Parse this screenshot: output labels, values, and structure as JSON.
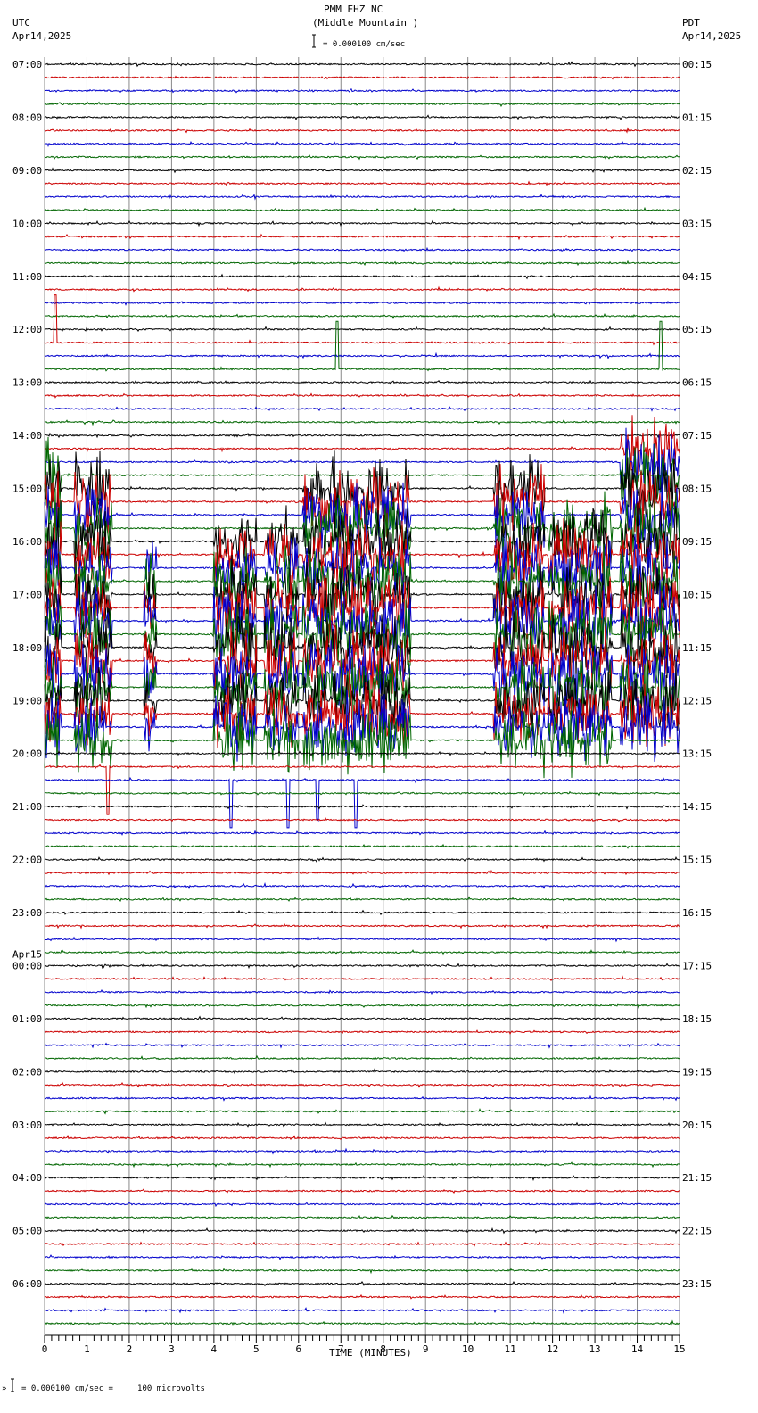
{
  "header": {
    "title": "PMM EHZ NC",
    "subtitle": "(Middle Mountain )",
    "left_tz": "UTC",
    "left_date": "Apr14,2025",
    "right_tz": "PDT",
    "right_date": "Apr14,2025",
    "scale_text": "= 0.000100 cm/sec"
  },
  "footer": {
    "scale_text": "= 0.000100 cm/sec =     100 microvolts"
  },
  "chart_data": {
    "type": "line",
    "title": "PMM EHZ NC (Middle Mountain )",
    "xlabel": "TIME (MINUTES)",
    "xlim": [
      0,
      15
    ],
    "x_ticks": [
      "0",
      "1",
      "2",
      "3",
      "4",
      "5",
      "6",
      "7",
      "8",
      "9",
      "10",
      "11",
      "12",
      "13",
      "14",
      "15"
    ],
    "trace_minutes": 15,
    "trace_count": 96,
    "trace_colors": [
      "#000000",
      "#cc0000",
      "#0000cc",
      "#006600"
    ],
    "left_labels": [
      "07:00",
      "08:00",
      "09:00",
      "10:00",
      "11:00",
      "12:00",
      "13:00",
      "14:00",
      "15:00",
      "16:00",
      "17:00",
      "18:00",
      "19:00",
      "20:00",
      "21:00",
      "22:00",
      "23:00",
      "00:00",
      "01:00",
      "02:00",
      "03:00",
      "04:00",
      "05:00",
      "06:00"
    ],
    "date_change_label": "Apr15",
    "right_labels": [
      "00:15",
      "01:15",
      "02:15",
      "03:15",
      "04:15",
      "05:15",
      "06:15",
      "07:15",
      "08:15",
      "09:15",
      "10:15",
      "11:15",
      "12:15",
      "13:15",
      "14:15",
      "15:15",
      "16:15",
      "17:15",
      "18:15",
      "19:15",
      "20:15",
      "21:15",
      "22:15",
      "23:15"
    ],
    "bursts": [
      {
        "trace_start": 31,
        "trace_end": 51,
        "t_start": 0.0,
        "t_end": 0.4,
        "relative_amplitude": 3.2
      },
      {
        "trace_start": 32,
        "trace_end": 51,
        "t_start": 0.7,
        "t_end": 1.6,
        "relative_amplitude": 3.0
      },
      {
        "trace_start": 38,
        "trace_end": 50,
        "t_start": 2.35,
        "t_end": 2.65,
        "relative_amplitude": 2.5
      },
      {
        "trace_start": 36,
        "trace_end": 51,
        "t_start": 4.0,
        "t_end": 5.0,
        "relative_amplitude": 3.0
      },
      {
        "trace_start": 36,
        "trace_end": 51,
        "t_start": 5.2,
        "t_end": 6.0,
        "relative_amplitude": 3.0
      },
      {
        "trace_start": 32,
        "trace_end": 51,
        "t_start": 6.1,
        "t_end": 8.65,
        "relative_amplitude": 3.0
      },
      {
        "trace_start": 32,
        "trace_end": 51,
        "t_start": 10.6,
        "t_end": 11.8,
        "relative_amplitude": 3.0
      },
      {
        "trace_start": 35,
        "trace_end": 51,
        "t_start": 11.9,
        "t_end": 13.4,
        "relative_amplitude": 3.0
      },
      {
        "trace_start": 29,
        "trace_end": 50,
        "t_start": 13.6,
        "t_end": 15.0,
        "relative_amplitude": 3.2
      }
    ],
    "spikes": [
      {
        "trace": 21,
        "t": 0.25,
        "relative_amplitude": 5
      },
      {
        "trace": 23,
        "t": 6.9,
        "relative_amplitude": 5
      },
      {
        "trace": 23,
        "t": 14.55,
        "relative_amplitude": 4
      },
      {
        "trace": 53,
        "t": 1.5,
        "relative_amplitude": -6
      },
      {
        "trace": 54,
        "t": 4.4,
        "relative_amplitude": -5
      },
      {
        "trace": 54,
        "t": 5.75,
        "relative_amplitude": -5
      },
      {
        "trace": 54,
        "t": 7.35,
        "relative_amplitude": -4
      },
      {
        "trace": 54,
        "t": 6.45,
        "relative_amplitude": -3
      }
    ]
  }
}
